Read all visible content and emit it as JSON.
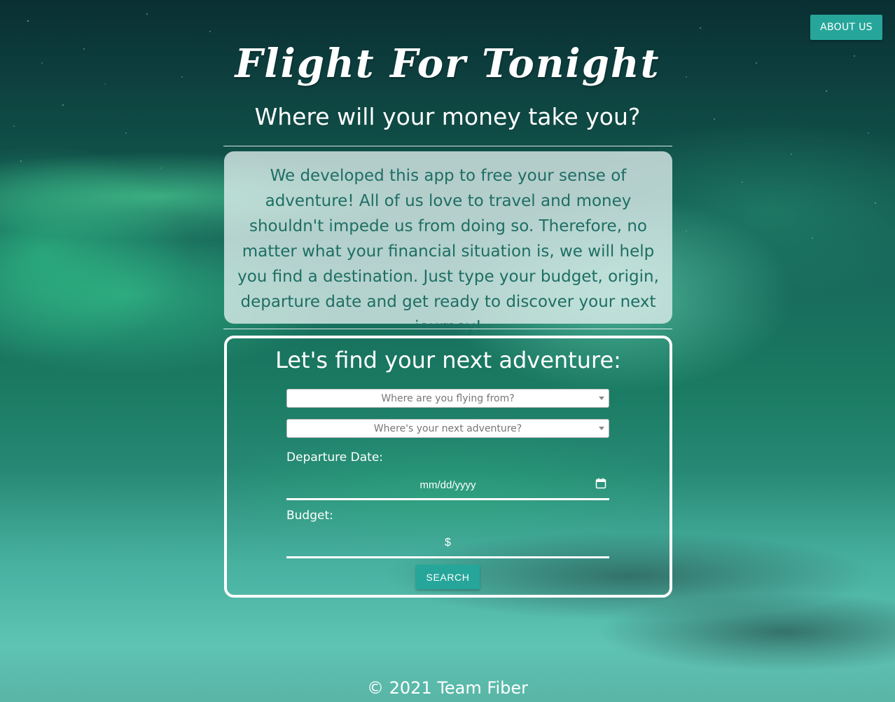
{
  "header": {
    "about_button_label": "ABOUT US",
    "title": "Flight For Tonight",
    "subtitle": "Where will your money take you?"
  },
  "about": {
    "text": "We developed this app to free your sense of adventure! All of us love to travel and money shouldn't impede us from doing so. Therefore, no matter what your financial situation is, we will help you find a destination. Just type your budget, origin, departure date and get ready to discover your next journey!"
  },
  "search": {
    "heading": "Let's find your next adventure:",
    "origin_placeholder": "Where are you flying from?",
    "destination_placeholder": "Where's your next adventure?",
    "departure_label": "Departure Date:",
    "date_placeholder": "mm/dd/yyyy",
    "budget_label": "Budget:",
    "budget_prefix": "$",
    "search_button_label": "SEARCH"
  },
  "footer": {
    "copyright": "© 2021 Team Fiber"
  },
  "colors": {
    "accent": "#26a69a",
    "about_text": "#1e6e64"
  },
  "icons": {
    "date_picker": "calendar-icon",
    "select_arrow": "caret-down-icon"
  }
}
